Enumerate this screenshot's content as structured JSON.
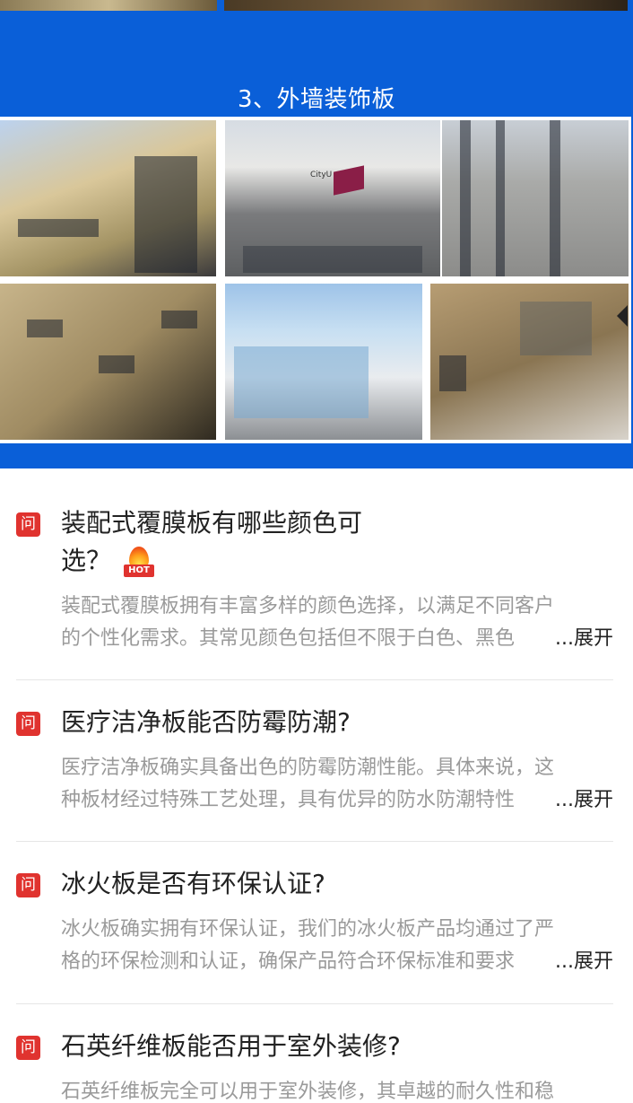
{
  "section": {
    "title": "3、外墙装饰板"
  },
  "gallery": {
    "images": [
      "exterior-panel-building-1",
      "exterior-panel-building-2",
      "exterior-panel-building-3",
      "exterior-panel-building-4",
      "exterior-panel-building-5",
      "exterior-panel-building-6"
    ],
    "logo_text": "CityU"
  },
  "faq": {
    "badge": "问",
    "hot_label": "HOT",
    "expand_label": "...展开",
    "items": [
      {
        "question": "装配式覆膜板有哪些颜色可选？",
        "answer_line1": "装配式覆膜板拥有丰富多样的颜色选择，以满足不同客户",
        "answer_line2": "的个性化需求。其常见颜色包括但不限于白色、黑色",
        "hot": true
      },
      {
        "question": "医疗洁净板能否防霉防潮?",
        "answer_line1": "医疗洁净板确实具备出色的防霉防潮性能。具体来说，这",
        "answer_line2": "种板材经过特殊工艺处理，具有优异的防水防潮特性"
      },
      {
        "question": "冰火板是否有环保认证?",
        "answer_line1": "冰火板确实拥有环保认证，我们的冰火板产品均通过了严",
        "answer_line2": "格的环保检测和认证，确保产品符合环保标准和要求"
      },
      {
        "question": "石英纤维板能否用于室外装修?",
        "answer_line1": "石英纤维板完全可以用于室外装修，其卓越的耐久性和稳"
      }
    ]
  },
  "colors": {
    "brand_blue": "#0a5fd8",
    "badge_red": "#e0332f"
  }
}
